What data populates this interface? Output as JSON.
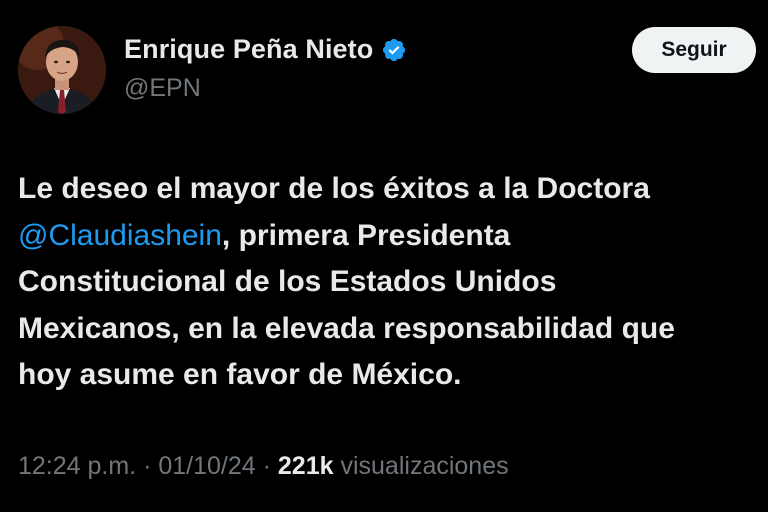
{
  "author": {
    "display_name": "Enrique Peña Nieto",
    "handle": "@EPN",
    "verified": true,
    "avatar_icon": "profile-photo"
  },
  "follow_button": {
    "label": "Seguir"
  },
  "tweet": {
    "line1": "Le deseo el mayor de los éxitos a la Doctora",
    "mention": "@Claudiashein",
    "line2_rest": ", primera Presidenta",
    "line3": "Constitucional de los Estados Unidos",
    "line4": "Mexicanos, en la elevada responsabilidad que",
    "line5": "hoy asume en favor de México."
  },
  "meta": {
    "time": "12:24 p.m.",
    "sep1": " · ",
    "date": "01/10/24",
    "sep2": " · ",
    "views_count": "221k",
    "views_label": " visualizaciones"
  },
  "colors": {
    "background": "#000000",
    "text": "#e7e9ea",
    "secondary": "#71767b",
    "link": "#1d9bf0",
    "verified": "#1d9bf0",
    "button_bg": "#eff3f4"
  }
}
